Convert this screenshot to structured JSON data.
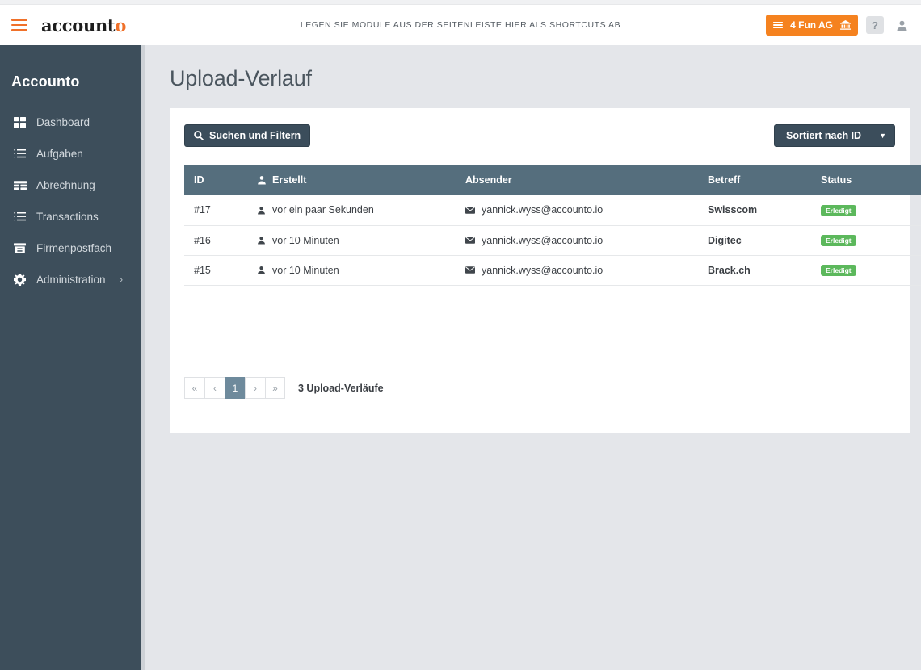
{
  "topbar": {
    "menu_icon": "hamburger-icon",
    "brand_main": "account",
    "brand_accent": "o",
    "hint": "LEGEN SIE MODULE AUS DER SEITENLEISTE HIER ALS SHORTCUTS AB",
    "company_label": "4 Fun AG",
    "company_color": "#f5821f",
    "help_label": "?",
    "avatar_icon": "user-icon",
    "bank_icon": "bank-icon"
  },
  "sidebar": {
    "title": "Accounto",
    "background": "#3d4e5b",
    "items": [
      {
        "label": "Dashboard",
        "icon": "grid-icon",
        "chevron": ""
      },
      {
        "label": "Aufgaben",
        "icon": "task-list-icon",
        "chevron": ""
      },
      {
        "label": "Abrechnung",
        "icon": "table-rows-icon",
        "chevron": ""
      },
      {
        "label": "Transactions",
        "icon": "task-list-icon",
        "chevron": ""
      },
      {
        "label": "Firmenpostfach",
        "icon": "archive-icon",
        "chevron": ""
      },
      {
        "label": "Administration",
        "icon": "gear-icon",
        "chevron": "›"
      }
    ]
  },
  "main": {
    "page_title": "Upload-Verlauf",
    "search_button": "Suchen und Filtern",
    "sort_button": "Sortiert nach ID",
    "sort_caret": "▼",
    "table": {
      "columns": [
        "ID",
        "Erstellt",
        "Absender",
        "Betreff",
        "Status"
      ],
      "rows": [
        {
          "id": "#17",
          "created": "vor ein paar Sekunden",
          "sender": "yannick.wyss@accounto.io",
          "subject": "Swisscom",
          "status": "Erledigt"
        },
        {
          "id": "#16",
          "created": "vor 10 Minuten",
          "sender": "yannick.wyss@accounto.io",
          "subject": "Digitec",
          "status": "Erledigt"
        },
        {
          "id": "#15",
          "created": "vor 10 Minuten",
          "sender": "yannick.wyss@accounto.io",
          "subject": "Brack.ch",
          "status": "Erledigt"
        }
      ],
      "status_color": "#5cb85c",
      "header_color": "#556e7d"
    },
    "pagination": {
      "first": "«",
      "prev": "‹",
      "pages": [
        "1"
      ],
      "next": "›",
      "last": "»",
      "current": "1",
      "count_label": "3 Upload-Verläufe"
    }
  }
}
